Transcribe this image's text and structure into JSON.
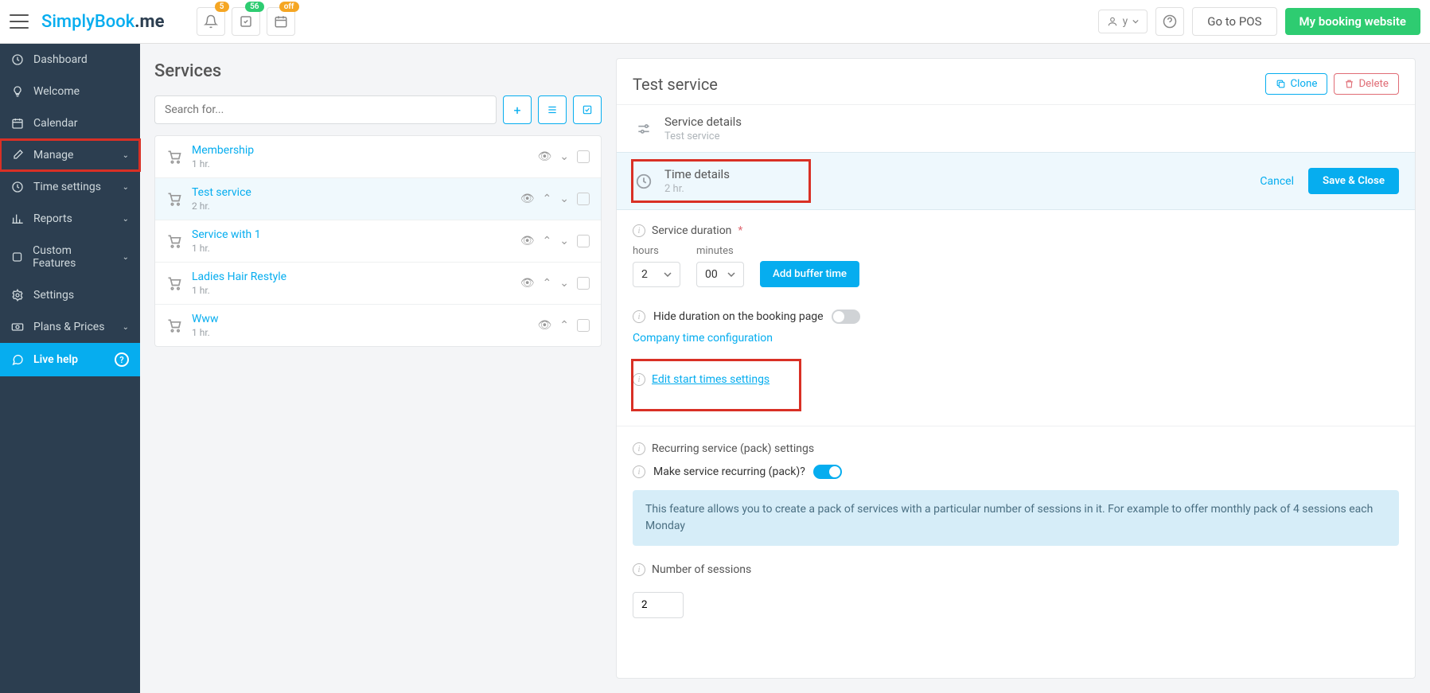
{
  "topbar": {
    "logo_main": "SimplyBook",
    "logo_suffix": ".me",
    "badge1": "5",
    "badge2": "56",
    "badge3": "off",
    "user": "y",
    "pos": "Go to POS",
    "booking": "My booking website"
  },
  "sidebar": {
    "items": [
      {
        "label": "Dashboard"
      },
      {
        "label": "Welcome"
      },
      {
        "label": "Calendar"
      },
      {
        "label": "Manage"
      },
      {
        "label": "Time settings"
      },
      {
        "label": "Reports"
      },
      {
        "label": "Custom Features"
      },
      {
        "label": "Settings"
      },
      {
        "label": "Plans & Prices"
      },
      {
        "label": "Live help"
      }
    ]
  },
  "services": {
    "title": "Services",
    "search_placeholder": "Search for...",
    "list": [
      {
        "name": "Membership",
        "dur": "1 hr."
      },
      {
        "name": "Test service",
        "dur": "2 hr."
      },
      {
        "name": "Service with 1",
        "dur": "1 hr."
      },
      {
        "name": "Ladies Hair Restyle",
        "dur": "1 hr."
      },
      {
        "name": "Www",
        "dur": "1 hr."
      }
    ]
  },
  "detail": {
    "title": "Test service",
    "clone": "Clone",
    "delete": "Delete",
    "sd_title": "Service details",
    "sd_sub": "Test service",
    "td_title": "Time details",
    "td_sub": "2 hr.",
    "cancel": "Cancel",
    "save": "Save & Close",
    "dur_label": "Service duration",
    "hours_label": "hours",
    "minutes_label": "minutes",
    "hours_val": "2",
    "minutes_val": "00",
    "buffer": "Add buffer time",
    "hide_dur": "Hide duration on the booking page",
    "company_time": "Company time configuration",
    "edit_start": "Edit start times settings",
    "recurring_title": "Recurring service (pack) settings",
    "recurring_q": "Make service recurring (pack)?",
    "banner": "This feature allows you to create a pack of services with a particular number of sessions in it. For example to offer monthly pack of 4 sessions each Monday",
    "sessions_label": "Number of sessions",
    "sessions_val": "2"
  }
}
